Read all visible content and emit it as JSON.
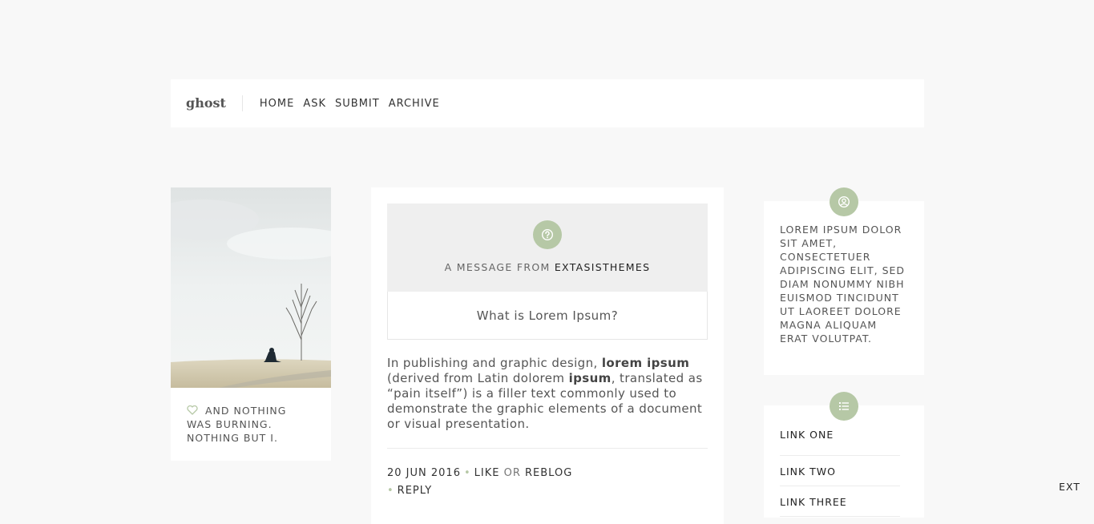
{
  "header": {
    "logo": "ghost",
    "nav": [
      "HOME",
      "ASK",
      "SUBMIT",
      "ARCHIVE"
    ]
  },
  "left_card": {
    "caption": "AND NOTHING WAS BURNING. NOTHING BUT I."
  },
  "post": {
    "message_prefix": "A MESSAGE FROM",
    "asker": "EXTASISTHEMES",
    "question": "What is Lorem Ipsum?",
    "answer_parts": [
      "In publishing and graphic design, ",
      "lorem ipsum",
      " (derived from Latin dolorem ",
      "ipsum",
      ", translated as “pain itself”) is a filler text commonly used to demonstrate the graphic elements of a document or visual presentation."
    ],
    "date": "20 JUN 2016",
    "like": "LIKE",
    "or": "OR",
    "reblog": "REBLOG",
    "reply": "REPLY"
  },
  "sidebar": {
    "bio": "Lorem ipsum dolor sit amet, consectetuer adipiscing elit, sed diam nonummy nibh euismod tincidunt ut laoreet dolore magna aliquam erat volutpat.",
    "links": [
      "LINK ONE",
      "LINK TWO",
      "LINK THREE"
    ]
  },
  "corner_label": "EXT",
  "colors": {
    "accent": "#b6c8a6",
    "page_bg": "#f8f8f8",
    "card_bg": "#ffffff",
    "message_bg": "#efefef"
  }
}
